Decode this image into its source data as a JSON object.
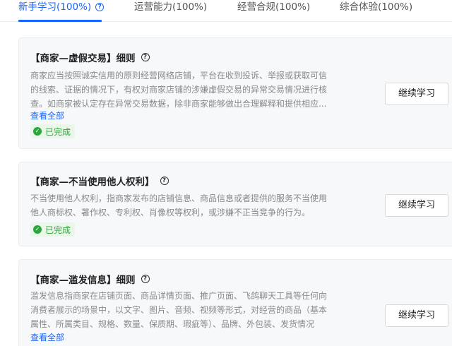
{
  "tabs": [
    {
      "label": "新手学习(100%)",
      "active": true
    },
    {
      "label": "运营能力(100%)",
      "active": false
    },
    {
      "label": "经营合规(100%)",
      "active": false
    },
    {
      "label": "综合体验(100%)",
      "active": false
    }
  ],
  "colors": {
    "accent": "#1966ff",
    "done_text": "#2ba63c",
    "done_bg": "#eaf7e8",
    "card_bg": "#f7f8fa"
  },
  "cards": [
    {
      "title": "【商家—虚假交易】细则",
      "desc_lines": [
        "商家应当按照诚实信用的原则经营网络店铺，平台在收到投诉、举报或获取可信",
        "的线索、证据的情况下，有权对商家店铺的涉嫌虚假交易的异常交易情况进行核",
        "查。如商家被认定存在异常交易数据，除非商家能够做出合理解释和提供相应..."
      ],
      "view_all": "查看全部",
      "status": "已完成",
      "button": "继续学习"
    },
    {
      "title": "【商家—不当使用他人权利】",
      "desc_lines": [
        "不当使用他人权利，指商家发布的店铺信息、商品信息或者提供的服务不当使用",
        "他人商标权、著作权、专利权、肖像权等权利，或涉嫌不正当竞争的行为。"
      ],
      "status": "已完成",
      "button": "继续学习"
    },
    {
      "title": "【商家—滥发信息】细则",
      "desc_lines": [
        "滥发信息指商家在店铺页面、商品详情页面、推广页面、飞鸽聊天工具等任何向",
        "消费者展示的场景中，以文字、图片、音频、视频等形式，对经营的商品（基本",
        "属性、所属类目、规格、数量、保质期、瑕疵等）、品牌、外包装、发货情况"
      ],
      "view_all": "查看全部",
      "button": "继续学习"
    }
  ]
}
